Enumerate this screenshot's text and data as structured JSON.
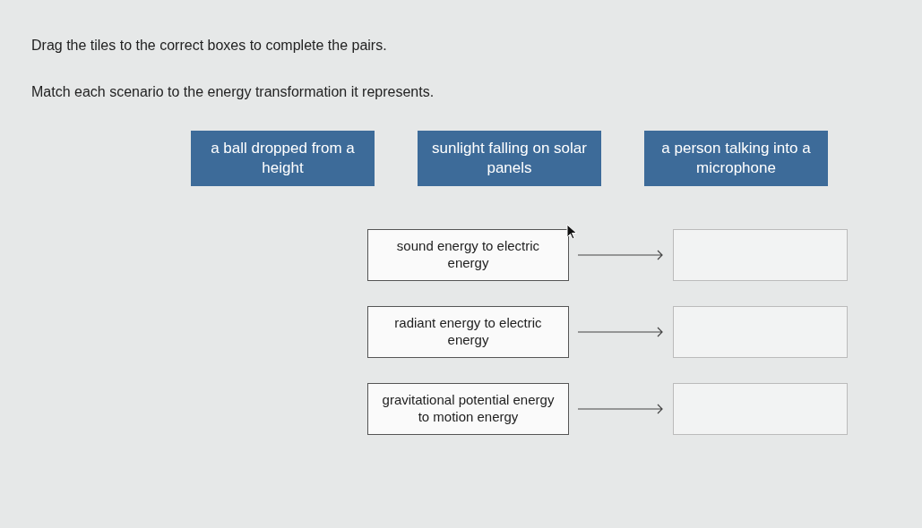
{
  "instructions": [
    "Drag the tiles to the correct boxes to complete the pairs.",
    "Match each scenario to the energy transformation it represents."
  ],
  "tiles": [
    {
      "label": "a ball dropped from a height"
    },
    {
      "label": "sunlight falling on solar panels"
    },
    {
      "label": "a person talking into a microphone"
    }
  ],
  "pairs": [
    {
      "prompt": "sound energy to electric energy"
    },
    {
      "prompt": "radiant energy to electric energy"
    },
    {
      "prompt": "gravitational potential energy to motion energy"
    }
  ]
}
